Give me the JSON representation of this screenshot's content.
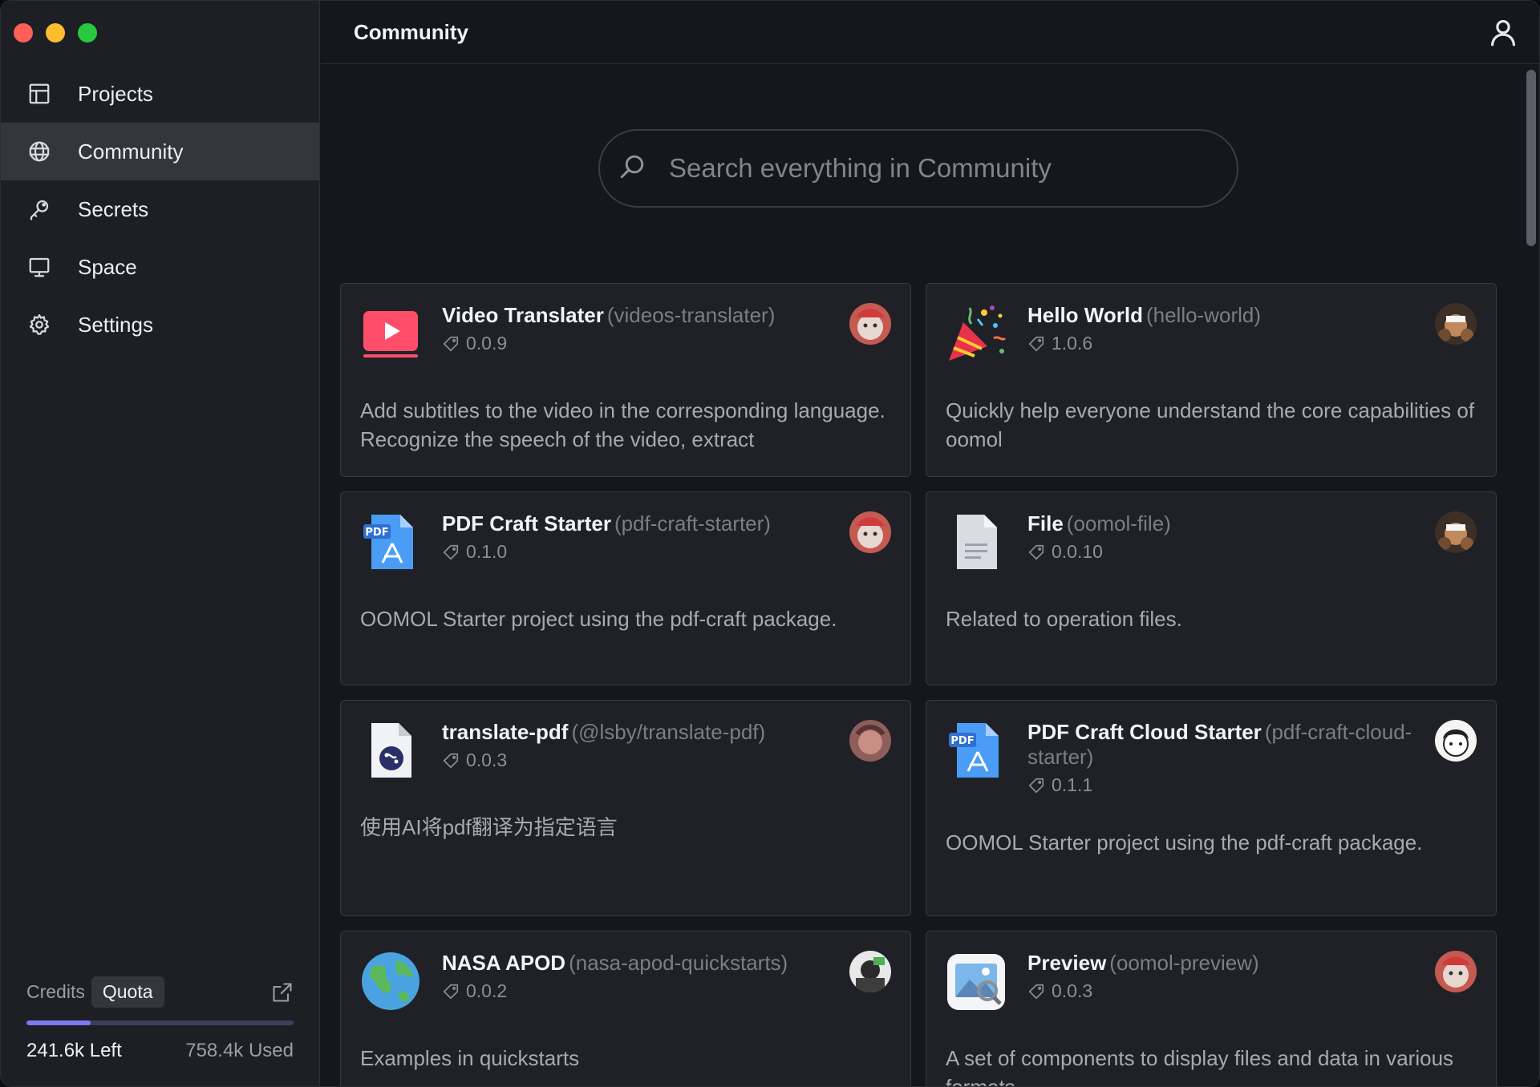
{
  "sidebar": {
    "items": [
      {
        "label": "Projects",
        "icon": "grid-icon"
      },
      {
        "label": "Community",
        "icon": "globe-icon",
        "active": true
      },
      {
        "label": "Secrets",
        "icon": "key-icon"
      },
      {
        "label": "Space",
        "icon": "monitor-icon"
      },
      {
        "label": "Settings",
        "icon": "gear-icon"
      }
    ],
    "credits": {
      "tabs": [
        "Credits",
        "Quota"
      ],
      "active_tab": "Quota",
      "left": "241.6k Left",
      "used": "758.4k Used",
      "used_fraction": 0.24
    }
  },
  "header": {
    "title": "Community"
  },
  "search": {
    "placeholder": "Search everything in Community",
    "value": ""
  },
  "cards": [
    {
      "name": "Video Translater",
      "slug": "(videos-translater)",
      "version": "0.0.9",
      "description": "Add subtitles to the video in the corresponding language. Recognize the speech of the video, extract",
      "icon": "video-play-icon"
    },
    {
      "name": "Hello World",
      "slug": "(hello-world)",
      "version": "1.0.6",
      "description": "Quickly help everyone understand the core capabilities of oomol",
      "icon": "party-popper-icon"
    },
    {
      "name": "PDF Craft Starter",
      "slug": "(pdf-craft-starter)",
      "version": "0.1.0",
      "description": "OOMOL Starter project using the pdf-craft package.",
      "icon": "pdf-file-icon"
    },
    {
      "name": "File",
      "slug": "(oomol-file)",
      "version": "0.0.10",
      "description": "Related to operation files.",
      "icon": "document-icon"
    },
    {
      "name": "translate-pdf",
      "slug": "(@lsby/translate-pdf)",
      "version": "0.0.3",
      "description": "使用AI将pdf翻译为指定语言",
      "icon": "script-file-icon"
    },
    {
      "name": "PDF Craft Cloud Starter",
      "slug": "(pdf-craft-cloud-starter)",
      "version": "0.1.1",
      "description": "OOMOL Starter project using the pdf-craft package.",
      "icon": "pdf-file-icon"
    },
    {
      "name": "NASA APOD",
      "slug": "(nasa-apod-quickstarts)",
      "version": "0.0.2",
      "description": "Examples in quickstarts",
      "icon": "globe-earth-icon"
    },
    {
      "name": "Preview",
      "slug": "(oomol-preview)",
      "version": "0.0.3",
      "description": "A set of components to display files and data in various formats",
      "icon": "preview-photo-icon"
    }
  ],
  "colors": {
    "accent": "#7c79f0",
    "sidebar_bg": "#1d1f24",
    "main_bg": "#15171c",
    "card_bg": "#1f2127"
  }
}
